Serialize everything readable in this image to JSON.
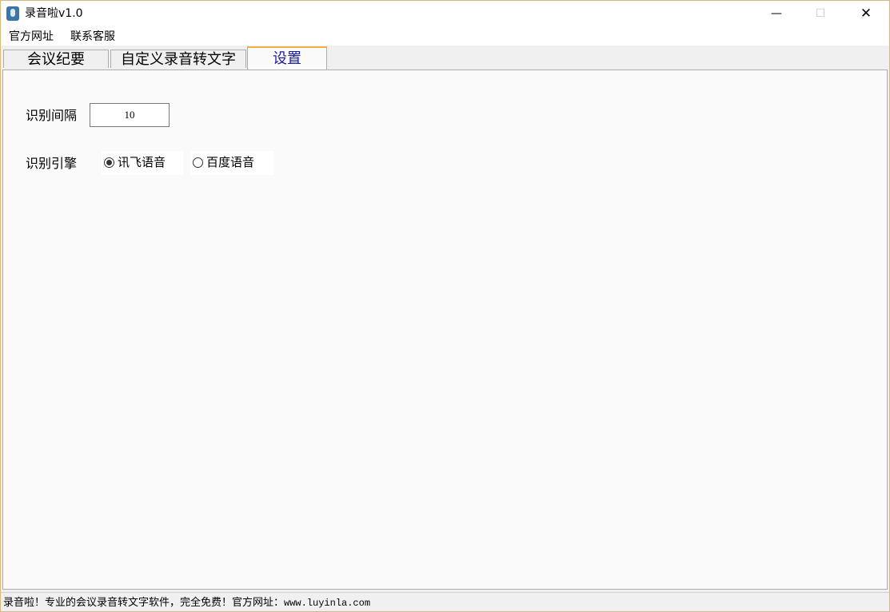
{
  "window": {
    "title": "录音啦v1.0",
    "controls": {
      "minimize": "—",
      "maximize": "☐",
      "close": "✕"
    }
  },
  "menu": {
    "website": "官方网址",
    "support": "联系客服"
  },
  "tabs": {
    "minutes": "会议纪要",
    "custom": "自定义录音转文字",
    "settings": "设置",
    "active": "设置"
  },
  "settings": {
    "interval_label": "识别间隔",
    "interval_value": "10",
    "engine_label": "识别引擎",
    "engines": [
      {
        "label": "讯飞语音",
        "selected": true
      },
      {
        "label": "百度语音",
        "selected": false
      }
    ]
  },
  "statusbar": {
    "text": "录音啦！专业的会议录音转文字软件，完全免费！官方网址：",
    "url": "www.luyinla.com"
  },
  "colors": {
    "active_tab_text": "#1a1aa8",
    "active_tab_accent": "#f0b040",
    "panel_bg": "#fafafb",
    "chrome_bg": "#f0f0f0"
  }
}
